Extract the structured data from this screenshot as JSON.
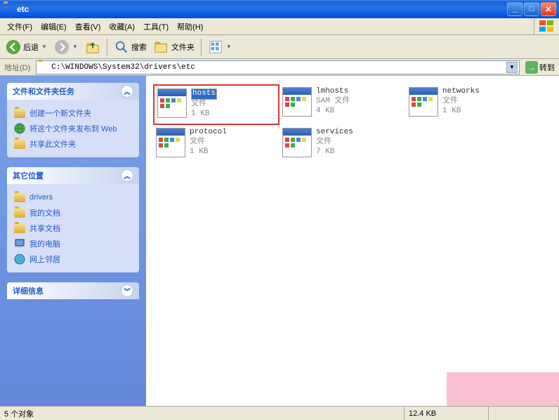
{
  "titlebar": {
    "title": "etc"
  },
  "menu": {
    "file": "文件(F)",
    "edit": "编辑(E)",
    "view": "查看(V)",
    "favorites": "收藏(A)",
    "tools": "工具(T)",
    "help": "帮助(H)"
  },
  "toolbar": {
    "back": "后退",
    "search": "搜索",
    "folders": "文件夹"
  },
  "address": {
    "label": "地址(D)",
    "path": "C:\\WINDOWS\\System32\\drivers\\etc",
    "go": "转到"
  },
  "sidebar": {
    "tasks": {
      "title": "文件和文件夹任务",
      "items": [
        "创建一个新文件夹",
        "将这个文件夹发布到 Web",
        "共享此文件夹"
      ]
    },
    "places": {
      "title": "其它位置",
      "items": [
        "drivers",
        "我的文档",
        "共享文档",
        "我的电脑",
        "网上邻居"
      ]
    },
    "details": {
      "title": "详细信息"
    }
  },
  "files": [
    {
      "name": "hosts",
      "type": "文件",
      "size": "1 KB",
      "selected": true
    },
    {
      "name": "lmhosts",
      "type": "SAM 文件",
      "size": "4 KB",
      "selected": false
    },
    {
      "name": "networks",
      "type": "文件",
      "size": "1 KB",
      "selected": false
    },
    {
      "name": "protocol",
      "type": "文件",
      "size": "1 KB",
      "selected": false
    },
    {
      "name": "services",
      "type": "文件",
      "size": "7 KB",
      "selected": false
    }
  ],
  "statusbar": {
    "count": "5 个对象",
    "size": "12.4 KB"
  }
}
